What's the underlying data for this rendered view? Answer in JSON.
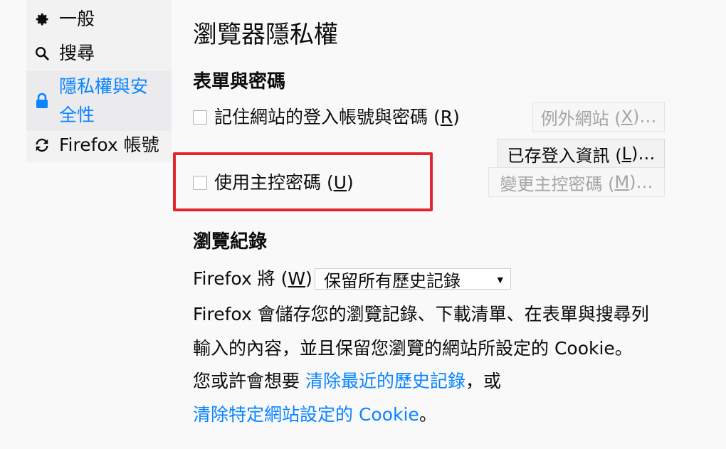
{
  "sidebar": {
    "items": [
      {
        "label": "一般",
        "icon": "gear-icon"
      },
      {
        "label": "搜尋",
        "icon": "search-icon"
      },
      {
        "label": "隱私權與安全性",
        "label_line1": "隱私權與安",
        "label_line2": "全性",
        "icon": "lock-icon",
        "selected": true
      },
      {
        "label": "Firefox 帳號",
        "icon": "sync-icon"
      }
    ]
  },
  "page": {
    "title": "瀏覽器隱私權"
  },
  "forms_passwords": {
    "heading": "表單與密碼",
    "remember_logins": {
      "label": "記住網站的登入帳號與密碼 (",
      "accesskey": "R",
      "suffix": ")",
      "checked": false
    },
    "exceptions_button": {
      "label": "例外網站 (",
      "accesskey": "X",
      "suffix": ")…",
      "disabled": true
    },
    "saved_logins_button": {
      "label": "已存登入資訊 (",
      "accesskey": "L",
      "suffix": ")…"
    },
    "master_password": {
      "label": "使用主控密碼 (",
      "accesskey": "U",
      "suffix": ")",
      "checked": false
    },
    "change_master_button": {
      "label": "變更主控密碼 (",
      "accesskey": "M",
      "suffix": ")…",
      "disabled": true
    }
  },
  "history": {
    "heading": "瀏覽紀錄",
    "firefox_will_label": "Firefox 將 (",
    "firefox_will_accesskey": "W",
    "firefox_will_suffix": ")",
    "mode_select_value": "保留所有歷史記錄",
    "description_line1": "Firefox 會儲存您的瀏覽記錄、下載清單、在表單與搜尋列",
    "description_line2": "輸入的內容，並且保留您瀏覽的網站所設定的 Cookie。",
    "suggestion_prefix": "您或許會想要 ",
    "clear_recent_link": "清除最近的歷史記錄",
    "suggestion_mid": "，或",
    "clear_cookies_link": "清除特定網站設定的 Cookie",
    "suggestion_end": "。"
  },
  "colors": {
    "accent": "#0a84ff",
    "highlight": "#e3262d",
    "background": "#f9f9fa"
  }
}
